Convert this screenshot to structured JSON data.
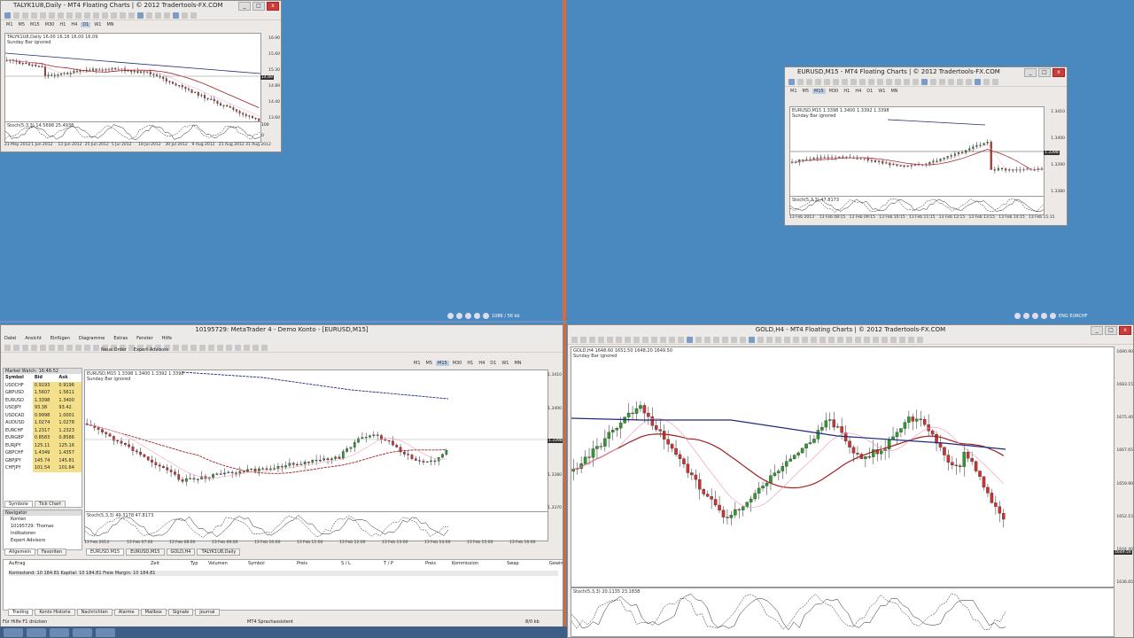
{
  "colors": {
    "desktop": "#4a88c0",
    "divider": "#d86a3a",
    "bull": "#2f9a2f",
    "bear": "#c33",
    "ma_red": "#a02020",
    "ma_blue": "#202a7a",
    "bands": "#f0a0c0"
  },
  "win1": {
    "title": "TALYK1U8,Daily - MT4 Floating Charts | © 2012 Tradertools-FX.COM",
    "tfs": [
      "M1",
      "M5",
      "M15",
      "M30",
      "H1",
      "H4",
      "D1",
      "W1",
      "MN"
    ],
    "tf_active": 6,
    "marks": [
      "1",
      "2",
      "3",
      "4"
    ],
    "info": "TALYK1U8,Daily  16.00 16.16 16.00 16.09",
    "info2": "Sunday Bar ignored",
    "yticks": [
      "16.90",
      "15.60",
      "15.30",
      "14.89",
      "14.40",
      "13.60"
    ],
    "price_tag": "14.89",
    "osc": "Stoch(5,3,3) 14.5698 25.4938",
    "osc_y": [
      "100",
      "0"
    ],
    "xticks": [
      "21 May 2012",
      "1 Jun 2012",
      "13 Jun 2012",
      "25 Jun 2012",
      "5 Jul 2012",
      "18 Jul 2012",
      "30 Jul 2012",
      "9 Aug 2012",
      "21 Aug 2012",
      "31 Aug 2012"
    ]
  },
  "win2": {
    "title": "EURUSD,M15 - MT4 Floating Charts | © 2012 Tradertools-FX.COM",
    "tfs": [
      "M1",
      "M5",
      "M15",
      "M30",
      "H1",
      "H4",
      "D1",
      "W1",
      "MN"
    ],
    "tf_active": 2,
    "info": "EURUSD,M15  1.3398 1.3400 1.3392 1.3398",
    "info2": "Sunday Bar ignored",
    "yticks": [
      "1.3410",
      "1.3400",
      "1.3390",
      "1.3380"
    ],
    "price_tag": "1.3398",
    "osc": "Stoch(5,3,3) 47.8173",
    "xticks": [
      "13 Feb 2013",
      "13 Feb 08:15",
      "13 Feb 09:15",
      "13 Feb 10:15",
      "13 Feb 11:15",
      "13 Feb 12:15",
      "13 Feb 13:15",
      "13 Feb 14:15",
      "13 Feb 15:15"
    ]
  },
  "tray_top": {
    "text": "1086 / 56 kb"
  },
  "tray_right": {
    "text": "ENG EURCHF"
  },
  "mt4": {
    "title": "10195729: MetaTrader 4 - Demo Konto - [EURUSD,M15]",
    "menu": [
      "Datei",
      "Ansicht",
      "Einfügen",
      "Diagramme",
      "Extras",
      "Fenster",
      "Hilfe"
    ],
    "new_order": "Neue Order",
    "expert": "Expert Advisors",
    "mw_title": "Market Watch: 16:46:52",
    "mw_head": [
      "Symbol",
      "Bid",
      "Ask"
    ],
    "mw_rows": [
      [
        "USDCHF",
        "0.9193",
        "0.9196"
      ],
      [
        "GBPUSD",
        "1.5607",
        "1.5611"
      ],
      [
        "EURUSD",
        "1.3398",
        "1.3400"
      ],
      [
        "USDJPY",
        "93.38",
        "93.42"
      ],
      [
        "USDCAD",
        "0.9998",
        "1.0001"
      ],
      [
        "AUDUSD",
        "1.0274",
        "1.0278"
      ],
      [
        "EURCHF",
        "1.2317",
        "1.2323"
      ],
      [
        "EURGBP",
        "0.8583",
        "0.8586"
      ],
      [
        "EURJPY",
        "125.11",
        "125.16"
      ],
      [
        "GBPCHF",
        "1.4349",
        "1.4357"
      ],
      [
        "GBPJPY",
        "145.74",
        "145.81"
      ],
      [
        "CHFJPY",
        "101.54",
        "101.64"
      ]
    ],
    "mw_tabs": [
      "Symbole",
      "Tick Chart"
    ],
    "nav_title": "Navigator",
    "nav_items": [
      "Konten",
      "10195729: Thomas",
      "Indikatoren",
      "Expert Advisors"
    ],
    "nav_tabs": [
      "Allgemein",
      "Favoriten"
    ],
    "chart": {
      "info": "EURUSD,M15  1.3398 1.3400 1.3392 1.3398",
      "info2": "Sunday Bar ignored",
      "yticks": [
        "1.3410",
        "1.3400",
        "1.3390",
        "1.3380",
        "1.3370"
      ],
      "price_tag": "1.3398",
      "osc": "Stoch(5,3,3) 49.3178 47.8173",
      "xticks": [
        "13 Feb 2013",
        "13 Feb 07:00",
        "13 Feb 08:00",
        "13 Feb 09:00",
        "13 Feb 10:00",
        "13 Feb 11:00",
        "13 Feb 12:00",
        "13 Feb 13:00",
        "13 Feb 14:00",
        "13 Feb 15:00",
        "13 Feb 16:00"
      ]
    },
    "chart_tabs": [
      "EURUSD,M15",
      "EURUSD,M15",
      "GOLD,H4",
      "TALYK1U8,Daily"
    ],
    "term_head": [
      "Auftrag",
      "Zeit",
      "Typ",
      "Volumen",
      "Symbol",
      "Preis",
      "S / L",
      "T / P",
      "Preis",
      "Kommission",
      "Swap",
      "Gewinn"
    ],
    "balance": "Kontostand: 10 184.81  Kapital: 10 184.81  Freie Margin: 10 184.81",
    "term_tabs": [
      "Trading",
      "Konto Historie",
      "Nachrichten",
      "Alarme",
      "Mailbox",
      "Signale",
      "Journal"
    ],
    "status_left": "Für Hilfe F1 drücken",
    "status_mid": "MT4 Sprachassistent",
    "status_right": "8/0 kb"
  },
  "gold": {
    "title": "GOLD,H4 - MT4 Floating Charts | © 2012 Tradertools-FX.COM",
    "tfs": [
      "M1",
      "M5",
      "M15",
      "M30",
      "H1",
      "H4",
      "D1",
      "W1",
      "MN"
    ],
    "tf_active": 5,
    "info": "GOLD,H4  1648.60 1651.50 1648.20 1649.50",
    "info2": "Sunday Bar ignored",
    "yticks": [
      "1690.90",
      "1683.15",
      "1675.40",
      "1667.65",
      "1659.90",
      "1652.15",
      "1644.40",
      "1636.65"
    ],
    "price_tag": "1649.50",
    "osc": "Stoch(5,3,3) 20.1135 23.1838"
  }
}
